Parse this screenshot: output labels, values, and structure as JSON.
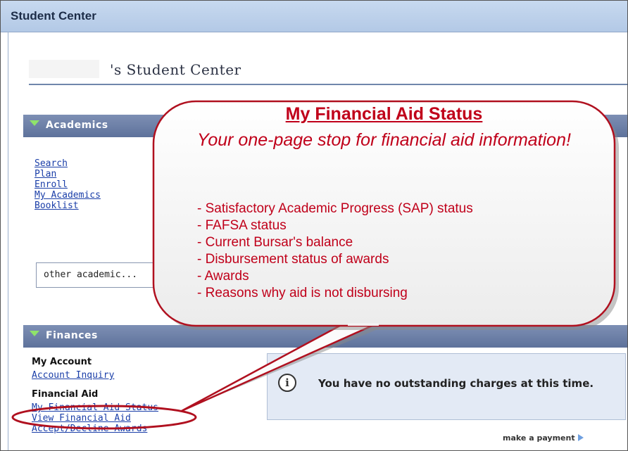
{
  "window": {
    "title": "Student Center"
  },
  "page": {
    "heading": "'s Student Center"
  },
  "academics": {
    "header": "Academics",
    "links": [
      "Search",
      "Plan",
      "Enroll",
      "My Academics",
      "Booklist"
    ],
    "select_value": "other academic..."
  },
  "finances": {
    "header": "Finances",
    "my_account_heading": "My Account",
    "account_inquiry": "Account Inquiry",
    "financial_aid_heading": "Financial Aid",
    "fa_links": [
      "My Financial Aid Status",
      "View Financial Aid",
      "Accept/Decline Awards"
    ],
    "notice_message": "You have no outstanding charges at this time.",
    "make_payment": "make a payment"
  },
  "callout": {
    "title": "My Financial Aid Status",
    "subtitle": "Your one-page stop for financial aid information!",
    "items": [
      "- Satisfactory Academic Progress (SAP) status",
      "- FAFSA status",
      "- Current Bursar's balance",
      "- Disbursement status of awards",
      "- Awards",
      "- Reasons why aid is not disbursing"
    ]
  },
  "colors": {
    "callout_red": "#c0001a",
    "section_header": "#6a7da5",
    "link_blue": "#1a3ea8",
    "expand_green": "#8fe36a"
  },
  "icons": {
    "section_expand": "triangle-down-icon",
    "info": "info-icon",
    "payment_arrow": "arrow-right-icon"
  }
}
